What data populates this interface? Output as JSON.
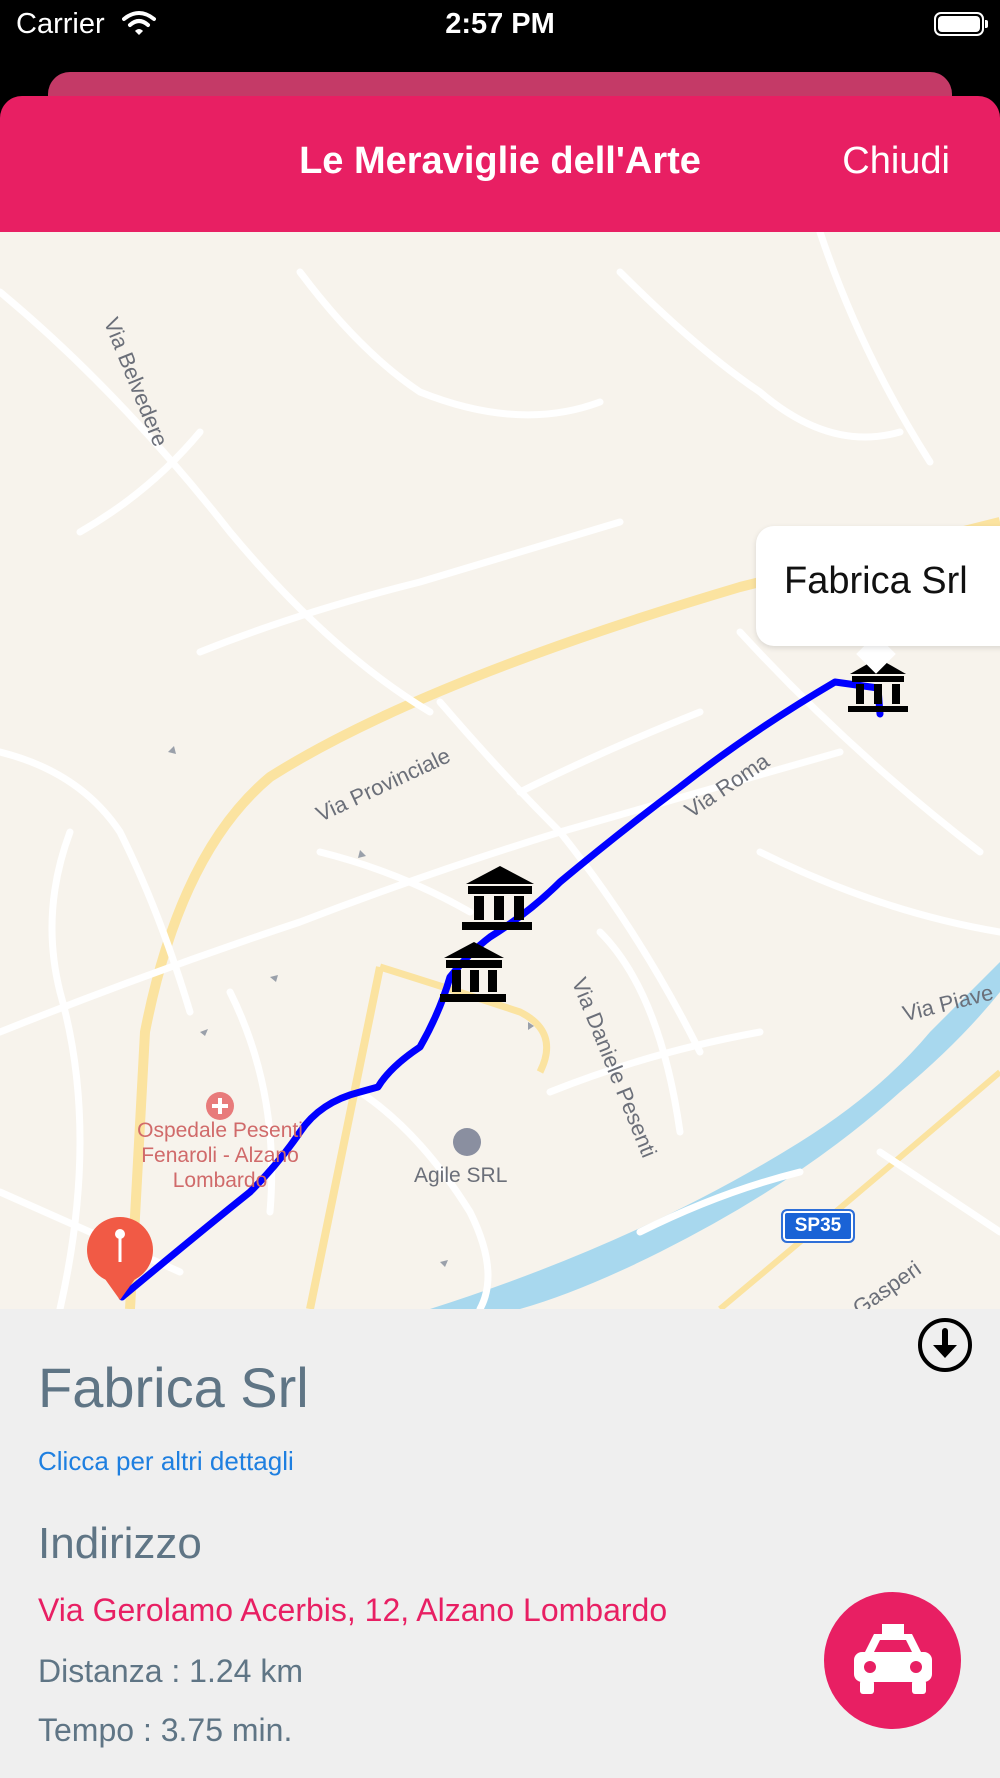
{
  "status_bar": {
    "carrier": "Carrier",
    "time": "2:57 PM"
  },
  "header": {
    "title": "Le Meraviglie dell'Arte",
    "close_label": "Chiudi"
  },
  "map": {
    "callout_title": "Fabrica Srl",
    "streets": [
      "Via Belvedere",
      "Via Provinciale",
      "Via Roma",
      "Via Daniele Pesenti",
      "Via Piave",
      "Gasperi"
    ],
    "hospital": "Ospedale Pesenti Fenaroli - Alzano Lombardo",
    "poi": "Agile SRL",
    "road_shield": "SP35",
    "route_color": "#0000ff"
  },
  "details": {
    "name": "Fabrica Srl",
    "more_link": "Clicca per altri dettagli",
    "address_heading": "Indirizzo",
    "address": "Via Gerolamo Acerbis, 12, Alzano Lombardo",
    "distance": "Distanza : 1.24 km",
    "time": "Tempo : 3.75  min."
  },
  "colors": {
    "accent": "#e81f63",
    "link": "#1e7fe0",
    "text_muted": "#5f7585"
  },
  "icons": [
    "wifi-icon",
    "battery-icon",
    "museum-icon",
    "pin-icon",
    "download-icon",
    "taxi-icon"
  ]
}
